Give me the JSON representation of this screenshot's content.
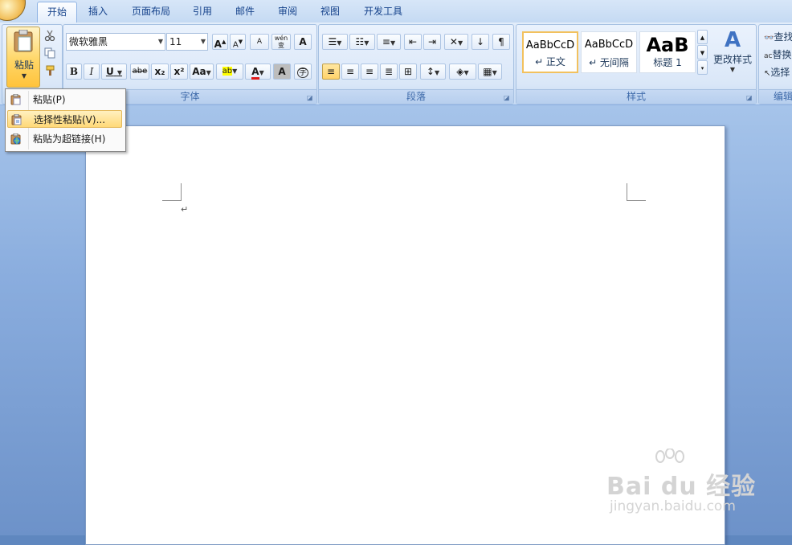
{
  "tabs": [
    "开始",
    "插入",
    "页面布局",
    "引用",
    "邮件",
    "审阅",
    "视图",
    "开发工具"
  ],
  "active_tab": "开始",
  "clipboard": {
    "paste_label": "粘贴",
    "cut_icon": "scissors-icon",
    "copy_icon": "copy-icon",
    "format_painter_icon": "format-painter-icon"
  },
  "font": {
    "group_label": "字体",
    "font_name": "微软雅黑",
    "font_size": "11",
    "bold": "B",
    "italic": "I",
    "underline": "U",
    "strikethrough": "abe",
    "subscript": "x₂",
    "superscript": "x²",
    "change_case": "Aa",
    "grow": "A",
    "shrink": "A",
    "clear": "A",
    "phonetic": "wén",
    "phonetic_char": "变",
    "char_border": "A",
    "highlight": "ab",
    "font_color": "A",
    "char_shading": "A",
    "enclose": "字"
  },
  "paragraph": {
    "group_label": "段落"
  },
  "styles": {
    "group_label": "样式",
    "items": [
      {
        "sample": "AaBbCcD",
        "name": "↵ 正文"
      },
      {
        "sample": "AaBbCcD",
        "name": "↵ 无间隔"
      },
      {
        "sample": "AaB",
        "name": "标题 1"
      }
    ],
    "change_styles_label": "更改样式"
  },
  "editing": {
    "group_label": "编辑",
    "find": "查找",
    "replace": "替换",
    "select": "选择"
  },
  "paste_menu": {
    "items": [
      {
        "label": "粘贴(P)",
        "icon": "paste-icon"
      },
      {
        "label": "选择性粘贴(V)...",
        "icon": "paste-special-icon"
      },
      {
        "label": "粘贴为超链接(H)",
        "icon": "paste-hyperlink-icon"
      }
    ],
    "hovered_index": 1
  },
  "document": {
    "paragraph_mark": "↵"
  },
  "watermark": {
    "main": "Bai du 经验",
    "sub": "jingyan.baidu.com"
  }
}
